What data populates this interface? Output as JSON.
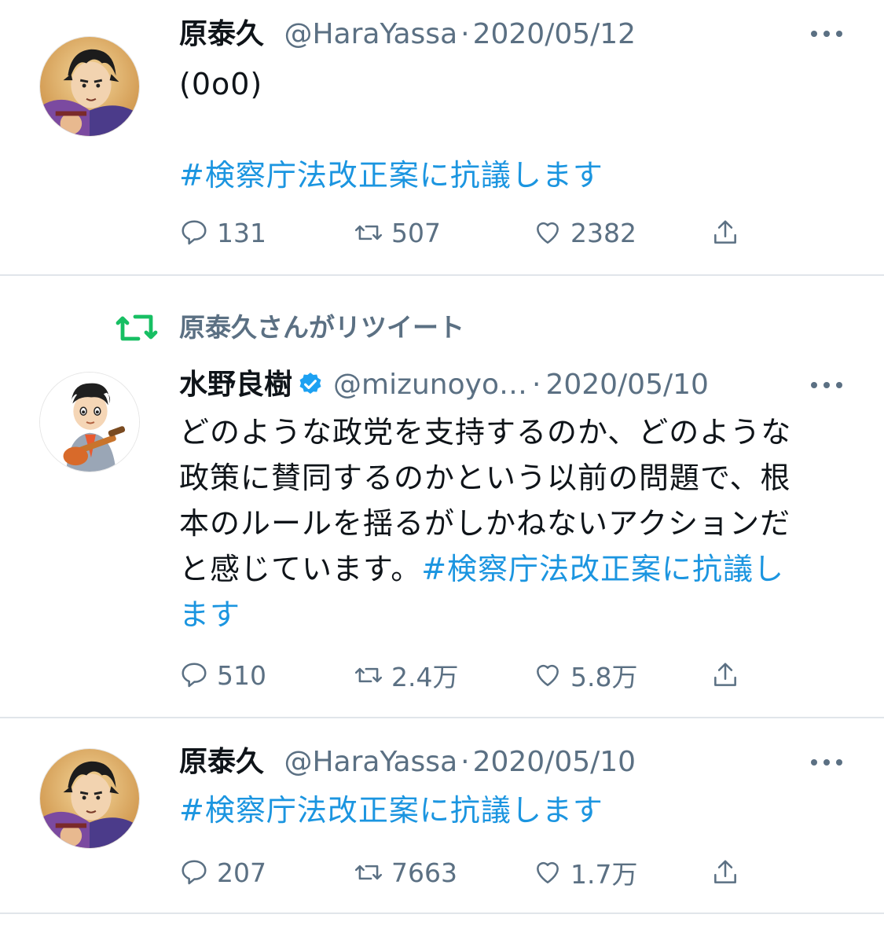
{
  "tweets": [
    {
      "name": "原泰久",
      "handle": "@HaraYassa",
      "dot": "·",
      "date": "2020/05/12",
      "text_line1": "(0o0)",
      "hashtag": "#検察庁法改正案に抗議します",
      "replies": "131",
      "retweets": "507",
      "likes": "2382"
    },
    {
      "retweeted_by": "原泰久さんがリツイート",
      "name": "水野良樹",
      "verified": true,
      "handle": "@mizunoyo…",
      "dot": "·",
      "date": "2020/05/10",
      "text_lines": [
        "どのような政党を支持するのか、どのような",
        "政策に賛同するのかという以前の問題で、根",
        "本のルールを揺るがしかねないアクションだ"
      ],
      "text_line4_prefix": "と感じています。",
      "hashtag_part1": "#検察庁法改正案に抗議し",
      "hashtag_part2": "ます",
      "replies": "510",
      "retweets": "2.4万",
      "likes": "5.8万"
    },
    {
      "name": "原泰久",
      "handle": "@HaraYassa",
      "dot": "·",
      "date": "2020/05/10",
      "hashtag": "#検察庁法改正案に抗議します",
      "replies": "207",
      "retweets": "7663",
      "likes": "1.7万"
    }
  ],
  "colors": {
    "text": "#0f1419",
    "secondary": "#5b7083",
    "link": "#1b95e0",
    "retweet_green": "#17bf63",
    "verified": "#1da1f2",
    "divider": "#e1e5ea"
  },
  "icons": [
    "reply-icon",
    "retweet-icon",
    "like-icon",
    "share-icon",
    "more-icon",
    "verified-badge-icon"
  ]
}
